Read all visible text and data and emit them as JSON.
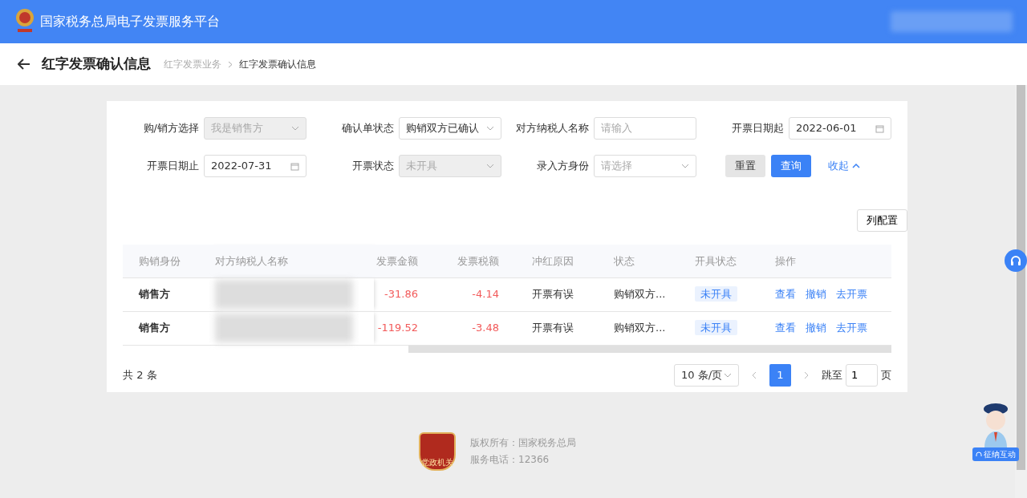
{
  "header": {
    "title": "国家税务总局电子发票服务平台"
  },
  "page": {
    "title": "红字发票确认信息",
    "breadcrumbs": [
      "红字发票业务",
      "红字发票确认信息"
    ]
  },
  "filters": [
    {
      "label": "购/销方选择",
      "kind": "select",
      "value": "我是销售方",
      "disabled": true
    },
    {
      "label": "确认单状态",
      "kind": "select",
      "value": "购销双方已确认",
      "disabled": false
    },
    {
      "label": "对方纳税人名称",
      "kind": "input",
      "placeholder": "请输入",
      "disabled": false
    },
    {
      "label": "开票日期起",
      "kind": "date",
      "value": "2022-06-01",
      "disabled": false
    },
    {
      "label": "开票日期止",
      "kind": "date",
      "value": "2022-07-31",
      "disabled": false
    },
    {
      "label": "开票状态",
      "kind": "select",
      "value": "未开具",
      "disabled": true
    },
    {
      "label": "录入方身份",
      "kind": "select",
      "placeholder": "请选择",
      "disabled": false
    }
  ],
  "actions": {
    "reset": "重置",
    "query": "查询",
    "collapse": "收起"
  },
  "column_config": "列配置",
  "table": {
    "columns": [
      "购销身份",
      "对方纳税人名称",
      "发票金额",
      "发票税额",
      "冲红原因",
      "状态",
      "开具状态",
      "操作"
    ],
    "rows": [
      {
        "role": "销售方",
        "amount": "-31.86",
        "tax": "-4.14",
        "reason": "开票有误",
        "status": "购销双方...",
        "issue_status": "未开具",
        "actions": [
          "查看",
          "撤销",
          "去开票"
        ]
      },
      {
        "role": "销售方",
        "amount": "-119.52",
        "tax": "-3.48",
        "reason": "开票有误",
        "status": "购销双方...",
        "issue_status": "未开具",
        "actions": [
          "查看",
          "撤销",
          "去开票"
        ]
      }
    ]
  },
  "pagination": {
    "total": "共 2 条",
    "page_size": "10 条/页",
    "pages": [
      {
        "label": "1",
        "selected": true
      }
    ],
    "jump_label": "跳至",
    "jump_value": "1",
    "unit": "页"
  },
  "footer": {
    "logo_text": "党政机关",
    "copyright": "版权所有：国家税务总局",
    "phone": "服务电话：12366"
  },
  "assistant": {
    "label": "征纳互动"
  }
}
